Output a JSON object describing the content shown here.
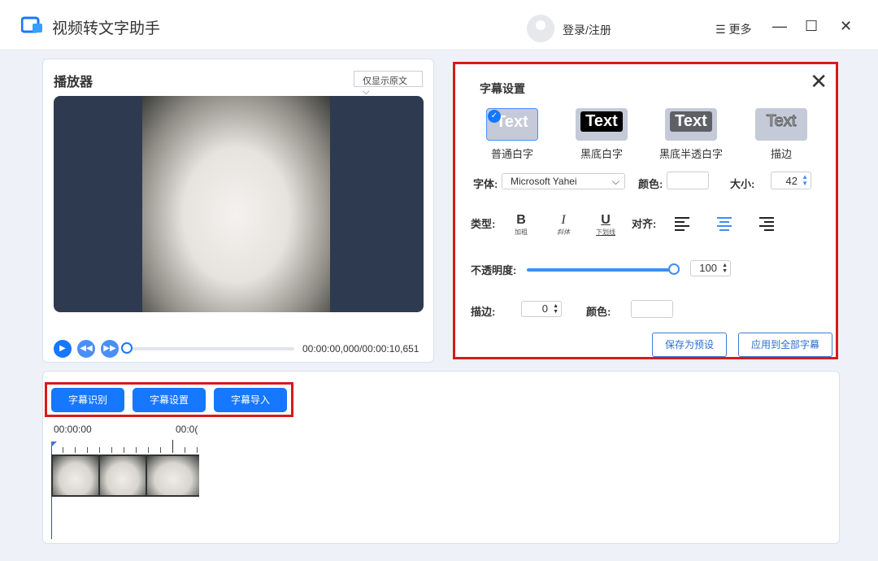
{
  "app": {
    "title": "视频转文字助手",
    "login": "登录/注册",
    "more": "更多"
  },
  "player": {
    "title": "播放器",
    "dropdown": "仅显示原文",
    "time": "00:00:00,000/00:00:10,651"
  },
  "subtitle_settings": {
    "title": "字幕设置",
    "presets": [
      {
        "sample": "Text",
        "label": "普通白字",
        "selected": true
      },
      {
        "sample": "Text",
        "label": "黑底白字"
      },
      {
        "sample": "Text",
        "label": "黑底半透白字"
      },
      {
        "sample": "Text",
        "label": "描边"
      }
    ],
    "font_label": "字体:",
    "font_value": "Microsoft Yahei",
    "color_label": "颜色:",
    "size_label": "大小:",
    "size_value": "42",
    "type_label": "类型:",
    "bold": "B",
    "bold_hint": "加粗",
    "italic": "I",
    "italic_hint": "斜体",
    "underline": "U",
    "underline_hint": "下划线",
    "align_label": "对齐:",
    "align_selected": "center",
    "opacity_label": "不透明度:",
    "opacity_value": "100",
    "stroke_label": "描边:",
    "stroke_value": "0",
    "stroke_color_label": "颜色:",
    "save_preset": "保存为预设",
    "apply_all": "应用到全部字幕"
  },
  "bottom": {
    "buttons": [
      "字幕识别",
      "字幕设置",
      "字幕导入"
    ],
    "timeline_start": "00:00:00",
    "timeline_next": "00:0("
  },
  "colors": {
    "accent": "#1677ff",
    "highlight": "#d71a1a"
  }
}
